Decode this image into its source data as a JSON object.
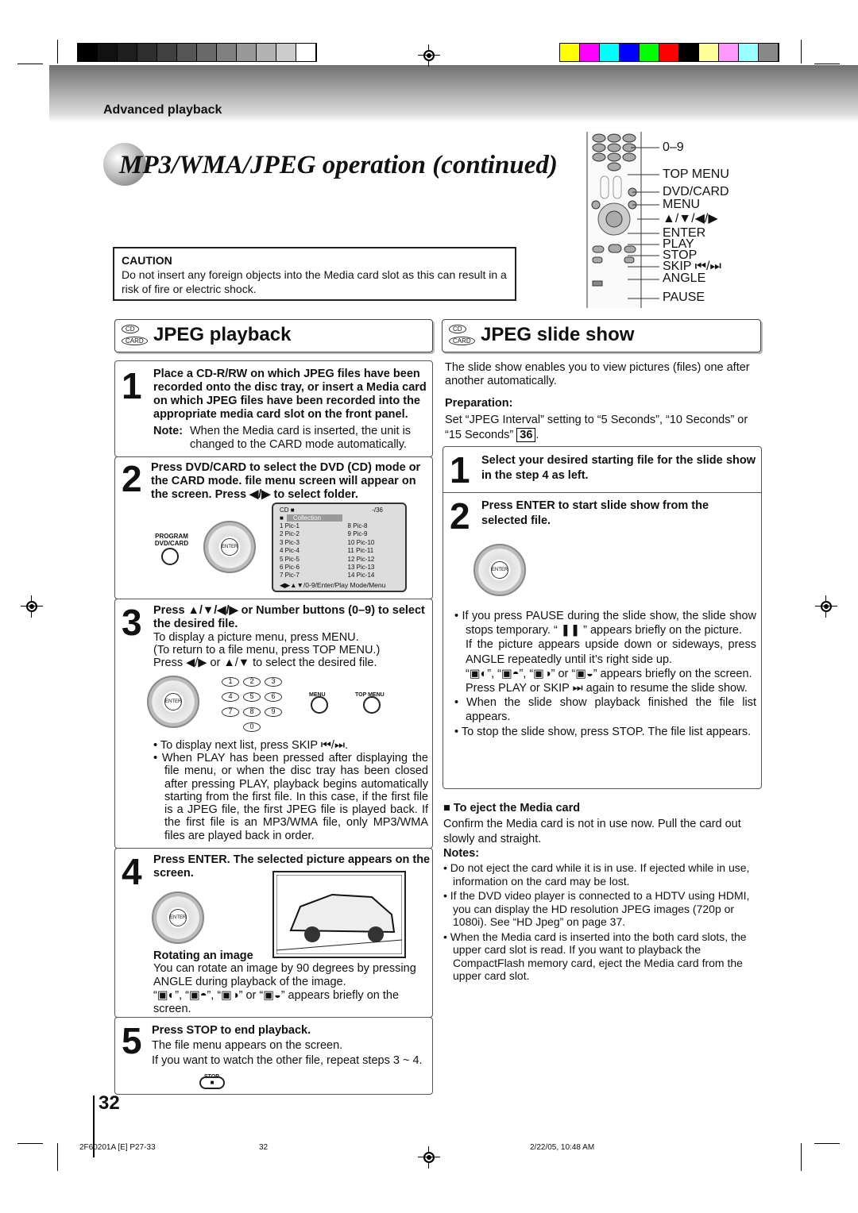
{
  "header": {
    "section": "Advanced playback",
    "title": "MP3/WMA/JPEG operation (continued)"
  },
  "colors": {
    "grayscale": [
      "#000",
      "#111",
      "#1e1e1e",
      "#2e2e2e",
      "#404040",
      "#555",
      "#6a6a6a",
      "#808080",
      "#999",
      "#b3b3b3",
      "#ccc",
      "#fff"
    ],
    "swatches": [
      "#ffff00",
      "#ff00ff",
      "#00ffff",
      "#0000ff",
      "#00ff00",
      "#ff0000",
      "#000000",
      "#ffff99",
      "#ff99ff",
      "#99ffff",
      "#888888"
    ]
  },
  "caution": {
    "heading": "CAUTION",
    "text": "Do not insert any foreign objects into the Media card slot as this can result in a risk of fire or electric shock."
  },
  "remote_labels": [
    "0–9",
    "TOP MENU",
    "DVD/CARD",
    "MENU",
    "▲/▼/◀/▶",
    "ENTER",
    "PLAY",
    "STOP",
    "SKIP ⏮/⏭",
    "ANGLE",
    "PAUSE"
  ],
  "disc_icons": {
    "cd": "CD",
    "card": "CARD"
  },
  "left": {
    "heading": "JPEG playback",
    "step1": {
      "num": "1",
      "text": "Place a CD-R/RW on which JPEG files have been recorded onto the disc tray, or insert a Media card on which JPEG files have been recorded into the appropriate media card slot on the front panel.",
      "note_label": "Note:",
      "note": "When the Media card is inserted, the unit is changed to the CARD mode automatically."
    },
    "step2": {
      "num": "2",
      "text": "Press DVD/CARD to select the DVD (CD) mode or the CARD mode. file menu screen will appear on the screen. Press ◀/▶ to select folder.",
      "btn_label": "PROGRAM DVD/CARD",
      "enter": "ENTER"
    },
    "screen": {
      "mode": "CD ■",
      "count": "-/36",
      "folder": "Collection",
      "files": [
        "1 Pic-1",
        "2 Pic-2",
        "3 Pic-3",
        "4 Pic-4",
        "5 Pic-5",
        "6 Pic-6",
        "7 Pic-7",
        "8 Pic-8",
        "9 Pic-9",
        "10 Pic-10",
        "11 Pic-11",
        "12 Pic-12",
        "13 Pic-13",
        "14 Pic-14"
      ],
      "footer": "◀▶▲▼/0-9/Enter/Play Mode/Menu"
    },
    "step3": {
      "num": "3",
      "text": "Press ▲/▼/◀/▶ or Number buttons (0–9) to select the desired file.",
      "l1": "To display a picture menu, press MENU.",
      "l2": "(To return to a file menu, press TOP MENU.)",
      "l3": "Press ◀/▶ or ▲/▼ to select the desired file.",
      "digits": [
        "1",
        "2",
        "3",
        "4",
        "5",
        "6",
        "7",
        "8",
        "9",
        "0"
      ],
      "menu": "MENU",
      "topmenu": "TOP MENU",
      "b1": "To display next list, press SKIP ⏮/⏭.",
      "b2": "When PLAY has been pressed after displaying the file menu, or when the disc tray has been closed after pressing PLAY, playback begins automatically starting from the first file. In this case, if the first file is a JPEG file, the first JPEG file is played back. If the first file is an MP3/WMA file, only MP3/WMA files are played back in order."
    },
    "step4": {
      "num": "4",
      "text": "Press ENTER. The selected picture appears on the screen.",
      "rot_head": "Rotating an image",
      "rot_text": "You can rotate an image by 90 degrees by pressing ANGLE during playback of the image.",
      "rot_icons": "“▣◐”, “▣◓”, “▣◑” or “▣◒” appears briefly on the screen."
    },
    "step5": {
      "num": "5",
      "text": "Press STOP to end playback.",
      "l1": "The file menu appears on the screen.",
      "l2": "If you want to watch the other file, repeat steps 3 ~ 4.",
      "stop": "STOP"
    }
  },
  "right": {
    "heading": "JPEG slide show",
    "intro": "The slide show enables you to view pictures (files) one after another automatically.",
    "prep_head": "Preparation:",
    "prep": "Set “JPEG Interval” setting to “5 Seconds”, “10 Seconds” or “15 Seconds”",
    "prep_page": "36",
    "step1": {
      "num": "1",
      "text": "Select your desired starting file for the slide show in the step 4 as left."
    },
    "step2": {
      "num": "2",
      "text": "Press ENTER to start slide show from the selected file."
    },
    "bullets": [
      "If you press PAUSE during the slide show, the slide show stops temporary. “ ❚❚ ” appears briefly on the picture.",
      "If the picture appears upside down or sideways, press ANGLE repeatedly until it’s right side up.",
      "“▣◐”, “▣◓”, “▣◑” or “▣◒” appears briefly on the screen.",
      "Press PLAY or SKIP ⏭ again to resume the slide show.",
      "When the slide show playback finished the file list appears.",
      "To stop the slide show, press STOP. The file list appears."
    ],
    "eject_head": "To eject the Media card",
    "eject": "Confirm the Media card is not in use now. Pull the card out slowly and straight.",
    "notes_head": "Notes:",
    "notes": [
      "Do not eject the card while it is in use. If ejected while in use, information on the card may be lost.",
      "If the DVD video player is connected to a HDTV using HDMI, you can display the HD resolution JPEG images (720p or 1080i). See “HD Jpeg” on page 37.",
      "When the Media card is inserted into the both card slots, the upper card slot is read. If you want to playback the CompactFlash memory card, eject the Media card from the upper card slot."
    ]
  },
  "page_number": "32",
  "footer": {
    "code": "2F60201A [E] P27-33",
    "page": "32",
    "date": "2/22/05, 10:48 AM"
  }
}
